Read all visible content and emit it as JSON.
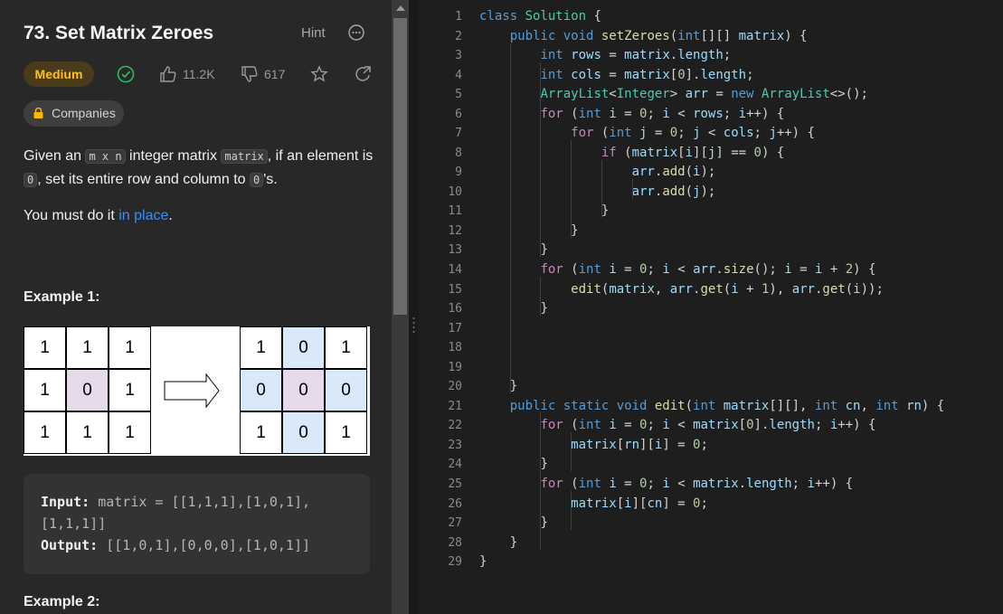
{
  "problem": {
    "title": "73. Set Matrix Zeroes",
    "hint_label": "Hint",
    "difficulty": "Medium",
    "likes": "11.2K",
    "dislikes": "617",
    "companies_label": "Companies",
    "desc": {
      "p1_a": "Given an ",
      "code_mxn": "m x n",
      "p1_b": " integer matrix ",
      "code_matrix": "matrix",
      "p1_c": ", if an element is ",
      "code_zero1": "0",
      "p1_d": ", set its entire row and column to ",
      "code_zero2": "0",
      "p1_e": "'s."
    },
    "para2_a": "You must do it ",
    "para2_link": "in place",
    "para2_b": ".",
    "example1_title": "Example 1:",
    "example2_title": "Example 2:",
    "input_label": "Input:",
    "input_line1": "matrix = [[1,1,1],[1,0,1],",
    "input_line2": "[1,1,1]]",
    "output_label": "Output:",
    "output_value": "[[1,0,1],[0,0,0],[1,0,1]]",
    "before_grid": [
      [
        "1",
        "1",
        "1"
      ],
      [
        "1",
        "0",
        "1"
      ],
      [
        "1",
        "1",
        "1"
      ]
    ],
    "after_grid": [
      [
        "1",
        "0",
        "1"
      ],
      [
        "0",
        "0",
        "0"
      ],
      [
        "1",
        "0",
        "1"
      ]
    ]
  },
  "colors": {
    "medium": "#ffc01e",
    "accepted_check": "#2cbb5d",
    "link": "#3b8df7",
    "keyword": "#569cd6",
    "control": "#c586c0",
    "type": "#4ec9b0",
    "method": "#dcdcaa",
    "variable": "#9cdcfe",
    "number": "#b5cea8",
    "highlight_purple": "#e6d9ea",
    "highlight_blue": "#dae8fc"
  },
  "icons": [
    "more-icon",
    "accepted-check-icon",
    "thumbs-up-icon",
    "thumbs-down-icon",
    "star-icon",
    "share-icon",
    "lock-icon"
  ],
  "editor": {
    "lines": [
      [
        [
          "class ",
          "k"
        ],
        [
          "Solution ",
          "t"
        ],
        [
          "{",
          "p"
        ]
      ],
      [
        [
          "    "
        ],
        [
          "public void ",
          "k"
        ],
        [
          "setZeroes",
          "m"
        ],
        [
          "(",
          "p"
        ],
        [
          "int",
          "k"
        ],
        [
          "[][] ",
          "p"
        ],
        [
          "matrix",
          "v"
        ],
        [
          ") {",
          "p"
        ]
      ],
      [
        [
          "        "
        ],
        [
          "int ",
          "k"
        ],
        [
          "rows",
          "v"
        ],
        [
          " = ",
          "p"
        ],
        [
          "matrix",
          "v"
        ],
        [
          ".",
          "p"
        ],
        [
          "length",
          "v"
        ],
        [
          ";",
          "p"
        ]
      ],
      [
        [
          "        "
        ],
        [
          "int ",
          "k"
        ],
        [
          "cols",
          "v"
        ],
        [
          " = ",
          "p"
        ],
        [
          "matrix",
          "v"
        ],
        [
          "[",
          "p"
        ],
        [
          "0",
          "n"
        ],
        [
          "].",
          "p"
        ],
        [
          "length",
          "v"
        ],
        [
          ";",
          "p"
        ]
      ],
      [
        [
          "        "
        ],
        [
          "ArrayList",
          "t"
        ],
        [
          "<",
          "p"
        ],
        [
          "Integer",
          "t"
        ],
        [
          "> ",
          "p"
        ],
        [
          "arr",
          "v"
        ],
        [
          " = ",
          "p"
        ],
        [
          "new ",
          "k"
        ],
        [
          "ArrayList",
          "t"
        ],
        [
          "<>();",
          "p"
        ]
      ],
      [
        [
          "        "
        ],
        [
          "for ",
          "c"
        ],
        [
          "(",
          "p"
        ],
        [
          "int ",
          "k"
        ],
        [
          "i",
          "v"
        ],
        [
          " = ",
          "p"
        ],
        [
          "0",
          "n"
        ],
        [
          "; ",
          "p"
        ],
        [
          "i",
          "v"
        ],
        [
          " < ",
          "p"
        ],
        [
          "rows",
          "v"
        ],
        [
          "; ",
          "p"
        ],
        [
          "i",
          "v"
        ],
        [
          "++) {",
          "p"
        ]
      ],
      [
        [
          "            "
        ],
        [
          "for ",
          "c"
        ],
        [
          "(",
          "p"
        ],
        [
          "int ",
          "k"
        ],
        [
          "j",
          "v"
        ],
        [
          " = ",
          "p"
        ],
        [
          "0",
          "n"
        ],
        [
          "; ",
          "p"
        ],
        [
          "j",
          "v"
        ],
        [
          " < ",
          "p"
        ],
        [
          "cols",
          "v"
        ],
        [
          "; ",
          "p"
        ],
        [
          "j",
          "v"
        ],
        [
          "++) {",
          "p"
        ]
      ],
      [
        [
          "                "
        ],
        [
          "if ",
          "c"
        ],
        [
          "(",
          "p"
        ],
        [
          "matrix",
          "v"
        ],
        [
          "[",
          "p"
        ],
        [
          "i",
          "v"
        ],
        [
          "][",
          "p"
        ],
        [
          "j",
          "v"
        ],
        [
          "] == ",
          "p"
        ],
        [
          "0",
          "n"
        ],
        [
          ") {",
          "p"
        ]
      ],
      [
        [
          "                    "
        ],
        [
          "arr",
          "v"
        ],
        [
          ".",
          "p"
        ],
        [
          "add",
          "m"
        ],
        [
          "(",
          "p"
        ],
        [
          "i",
          "v"
        ],
        [
          ");",
          "p"
        ]
      ],
      [
        [
          "                    "
        ],
        [
          "arr",
          "v"
        ],
        [
          ".",
          "p"
        ],
        [
          "add",
          "m"
        ],
        [
          "(",
          "p"
        ],
        [
          "j",
          "v"
        ],
        [
          ");",
          "p"
        ]
      ],
      [
        [
          "                "
        ],
        [
          "}",
          "p"
        ]
      ],
      [
        [
          "            "
        ],
        [
          "}",
          "p"
        ]
      ],
      [
        [
          "        "
        ],
        [
          "}",
          "p"
        ]
      ],
      [
        [
          "        "
        ],
        [
          "for ",
          "c"
        ],
        [
          "(",
          "p"
        ],
        [
          "int ",
          "k"
        ],
        [
          "i",
          "v"
        ],
        [
          " = ",
          "p"
        ],
        [
          "0",
          "n"
        ],
        [
          "; ",
          "p"
        ],
        [
          "i",
          "v"
        ],
        [
          " < ",
          "p"
        ],
        [
          "arr",
          "v"
        ],
        [
          ".",
          "p"
        ],
        [
          "size",
          "m"
        ],
        [
          "(); ",
          "p"
        ],
        [
          "i",
          "v"
        ],
        [
          " = ",
          "p"
        ],
        [
          "i",
          "v"
        ],
        [
          " + ",
          "p"
        ],
        [
          "2",
          "n"
        ],
        [
          ") {",
          "p"
        ]
      ],
      [
        [
          "            "
        ],
        [
          "edit",
          "m"
        ],
        [
          "(",
          "p"
        ],
        [
          "matrix",
          "v"
        ],
        [
          ", ",
          "p"
        ],
        [
          "arr",
          "v"
        ],
        [
          ".",
          "p"
        ],
        [
          "get",
          "m"
        ],
        [
          "(",
          "p"
        ],
        [
          "i",
          "v"
        ],
        [
          " + ",
          "p"
        ],
        [
          "1",
          "n"
        ],
        [
          "), ",
          "p"
        ],
        [
          "arr",
          "v"
        ],
        [
          ".",
          "p"
        ],
        [
          "get",
          "m"
        ],
        [
          "(",
          "p"
        ],
        [
          "i",
          "v"
        ],
        [
          "));",
          "p"
        ]
      ],
      [
        [
          "        "
        ],
        [
          "}",
          "p"
        ]
      ],
      [],
      [],
      [],
      [
        [
          "    "
        ],
        [
          "}",
          "p"
        ]
      ],
      [
        [
          "    "
        ],
        [
          "public static void ",
          "k"
        ],
        [
          "edit",
          "m"
        ],
        [
          "(",
          "p"
        ],
        [
          "int ",
          "k"
        ],
        [
          "matrix",
          "v"
        ],
        [
          "[][], ",
          "p"
        ],
        [
          "int ",
          "k"
        ],
        [
          "cn",
          "v"
        ],
        [
          ", ",
          "p"
        ],
        [
          "int ",
          "k"
        ],
        [
          "rn",
          "v"
        ],
        [
          ") {",
          "p"
        ]
      ],
      [
        [
          "        "
        ],
        [
          "for ",
          "c"
        ],
        [
          "(",
          "p"
        ],
        [
          "int ",
          "k"
        ],
        [
          "i",
          "v"
        ],
        [
          " = ",
          "p"
        ],
        [
          "0",
          "n"
        ],
        [
          "; ",
          "p"
        ],
        [
          "i",
          "v"
        ],
        [
          " < ",
          "p"
        ],
        [
          "matrix",
          "v"
        ],
        [
          "[",
          "p"
        ],
        [
          "0",
          "n"
        ],
        [
          "].",
          "p"
        ],
        [
          "length",
          "v"
        ],
        [
          "; ",
          "p"
        ],
        [
          "i",
          "v"
        ],
        [
          "++) {",
          "p"
        ]
      ],
      [
        [
          "            "
        ],
        [
          "matrix",
          "v"
        ],
        [
          "[",
          "p"
        ],
        [
          "rn",
          "v"
        ],
        [
          "][",
          "p"
        ],
        [
          "i",
          "v"
        ],
        [
          "] = ",
          "p"
        ],
        [
          "0",
          "n"
        ],
        [
          ";",
          "p"
        ]
      ],
      [
        [
          "        "
        ],
        [
          "}",
          "p"
        ]
      ],
      [
        [
          "        "
        ],
        [
          "for ",
          "c"
        ],
        [
          "(",
          "p"
        ],
        [
          "int ",
          "k"
        ],
        [
          "i",
          "v"
        ],
        [
          " = ",
          "p"
        ],
        [
          "0",
          "n"
        ],
        [
          "; ",
          "p"
        ],
        [
          "i",
          "v"
        ],
        [
          " < ",
          "p"
        ],
        [
          "matrix",
          "v"
        ],
        [
          ".",
          "p"
        ],
        [
          "length",
          "v"
        ],
        [
          "; ",
          "p"
        ],
        [
          "i",
          "v"
        ],
        [
          "++) {",
          "p"
        ]
      ],
      [
        [
          "            "
        ],
        [
          "matrix",
          "v"
        ],
        [
          "[",
          "p"
        ],
        [
          "i",
          "v"
        ],
        [
          "][",
          "p"
        ],
        [
          "cn",
          "v"
        ],
        [
          "] = ",
          "p"
        ],
        [
          "0",
          "n"
        ],
        [
          ";",
          "p"
        ]
      ],
      [
        [
          "        "
        ],
        [
          "}",
          "p"
        ]
      ],
      [
        [
          "    "
        ],
        [
          "}",
          "p"
        ]
      ],
      [
        [
          "}",
          "p"
        ]
      ]
    ]
  }
}
